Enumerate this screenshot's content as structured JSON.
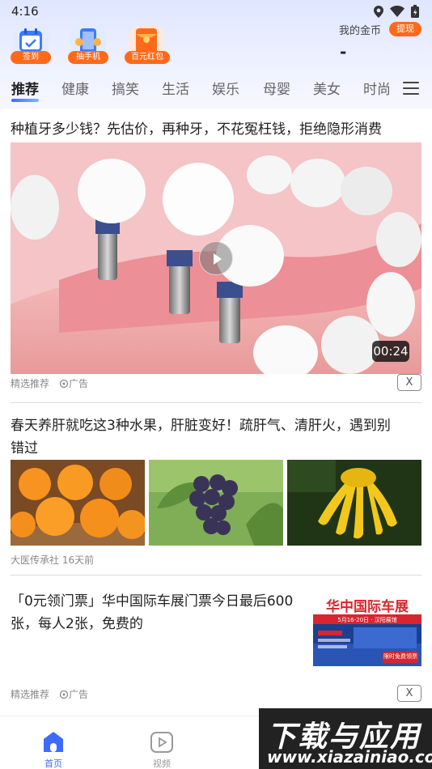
{
  "status": {
    "time": "4:16"
  },
  "quick_actions": [
    {
      "label": "签到",
      "icon": "calendar-icon",
      "color": "#3d7bff"
    },
    {
      "label": "抽手机",
      "icon": "phone-icon",
      "color": "#3d7bff"
    },
    {
      "label": "百元红包",
      "icon": "red-packet-icon",
      "color": "#ff6a1a"
    }
  ],
  "coins": {
    "label": "我的金币",
    "withdraw": "提现",
    "value": "-"
  },
  "tabs": [
    "推荐",
    "健康",
    "搞笑",
    "生活",
    "娱乐",
    "母婴",
    "美女",
    "时尚"
  ],
  "feed": {
    "item1": {
      "title": "种植牙多少钱？先估价，再种牙，不花冤枉钱，拒绝隐形消费",
      "duration": "00:24",
      "source": "精选推荐",
      "ad_label": "广告",
      "close": "X"
    },
    "item2": {
      "title_line1": "春天养肝就吃这3种水果，肝脏变好！疏肝气、清肝火，遇到别",
      "title_line2": "错过",
      "meta": "大医传承社  16天前"
    },
    "item3": {
      "title_line1": "「0元领门票」华中国际车展门票今日最后600",
      "title_line2": "张，每人2张，免费的",
      "ad_banner_title": "华中国际车展",
      "ad_banner_date": "5月16-20日 · 汉阳展馆",
      "ad_banner_cta": "限时免费领票",
      "source": "精选推荐",
      "ad_label": "广告",
      "close": "X"
    }
  },
  "bottom_nav": [
    {
      "label": "首页",
      "icon": "home-icon",
      "active": true
    },
    {
      "label": "视频",
      "icon": "video-icon",
      "active": false
    }
  ],
  "watermark": {
    "cn": "下载与应用",
    "url": "www.xiazainiao.com"
  },
  "colors": {
    "accent": "#3d6bff",
    "orange": "#ff6a1a"
  }
}
